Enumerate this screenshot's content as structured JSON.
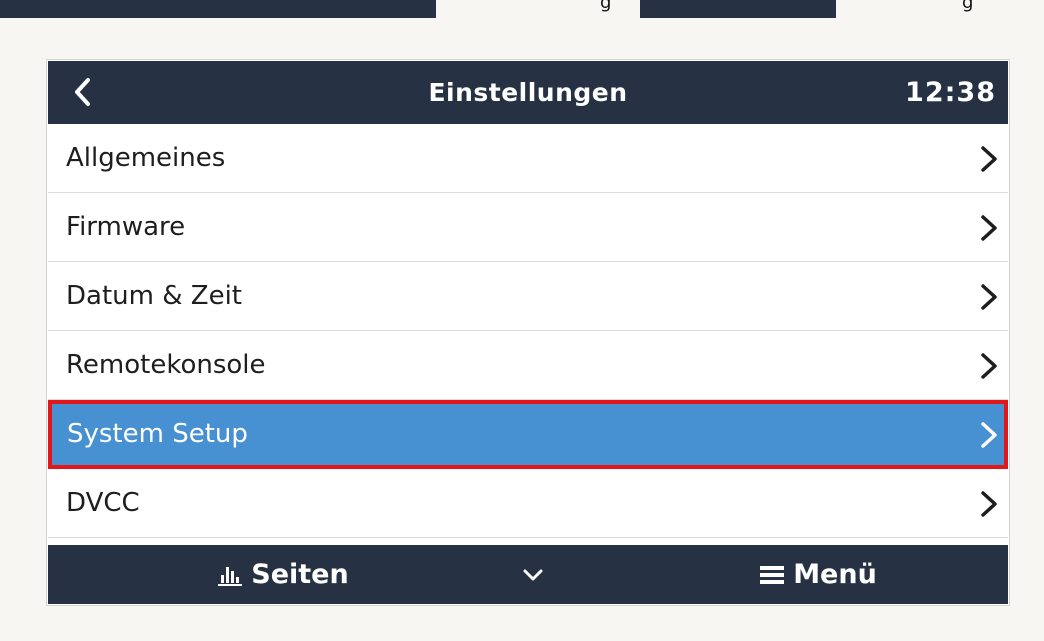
{
  "background_strip": {
    "text_fragment_left": "g",
    "text_fragment_right": "g"
  },
  "header": {
    "title": "Einstellungen",
    "time": "12:38",
    "back_icon": "chevron-left-icon"
  },
  "menu_items": [
    {
      "label": "Allgemeines",
      "icon": "chevron-right-icon",
      "selected": false
    },
    {
      "label": "Firmware",
      "icon": "chevron-right-icon",
      "selected": false
    },
    {
      "label": "Datum & Zeit",
      "icon": "chevron-right-icon",
      "selected": false
    },
    {
      "label": "Remotekonsole",
      "icon": "chevron-right-icon",
      "selected": false
    },
    {
      "label": "System Setup",
      "icon": "chevron-right-icon",
      "selected": true
    },
    {
      "label": "DVCC",
      "icon": "chevron-right-icon",
      "selected": false
    }
  ],
  "footer": {
    "pages_label": "Seiten",
    "pages_icon": "bar-chart-icon",
    "scroll_icon": "chevron-down-icon",
    "menu_label": "Menü",
    "menu_icon": "hamburger-icon"
  },
  "colors": {
    "header_bg": "#263244",
    "selected_bg": "#4791d2",
    "highlight_border": "#e3161a",
    "page_bg": "#f7f6f3"
  }
}
